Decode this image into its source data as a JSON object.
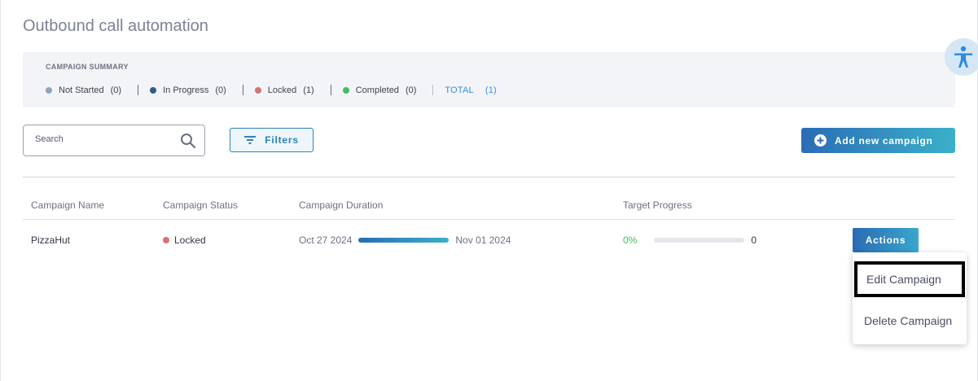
{
  "page": {
    "title": "Outbound call automation"
  },
  "summary": {
    "heading": "CAMPAIGN SUMMARY",
    "stats": [
      {
        "label": "Not Started",
        "count": "(0)",
        "color": "#8aa4be"
      },
      {
        "label": "In Progress",
        "count": "(0)",
        "color": "#2e5c8c"
      },
      {
        "label": "Locked",
        "count": "(1)",
        "color": "#d27476"
      },
      {
        "label": "Completed",
        "count": "(0)",
        "color": "#3fbf64"
      }
    ],
    "total": {
      "label": "TOTAL",
      "count": "(1)"
    }
  },
  "toolbar": {
    "search_placeholder": "Search",
    "filters_label": "Filters",
    "add_label": "Add new campaign"
  },
  "table": {
    "headers": [
      "Campaign Name",
      "Campaign Status",
      "Campaign Duration",
      "Target Progress"
    ],
    "rows": [
      {
        "name": "PizzaHut",
        "status": "Locked",
        "start": "Oct 27 2024",
        "end": "Nov 01 2024",
        "percent": "0%",
        "progress": 0,
        "target": "0",
        "actions_label": "Actions"
      }
    ]
  },
  "actions_menu": {
    "items": [
      "Edit Campaign",
      "Delete Campaign"
    ]
  },
  "icons": [
    "accessibility-icon",
    "search-icon",
    "filter-icon",
    "plus-circle-icon"
  ]
}
